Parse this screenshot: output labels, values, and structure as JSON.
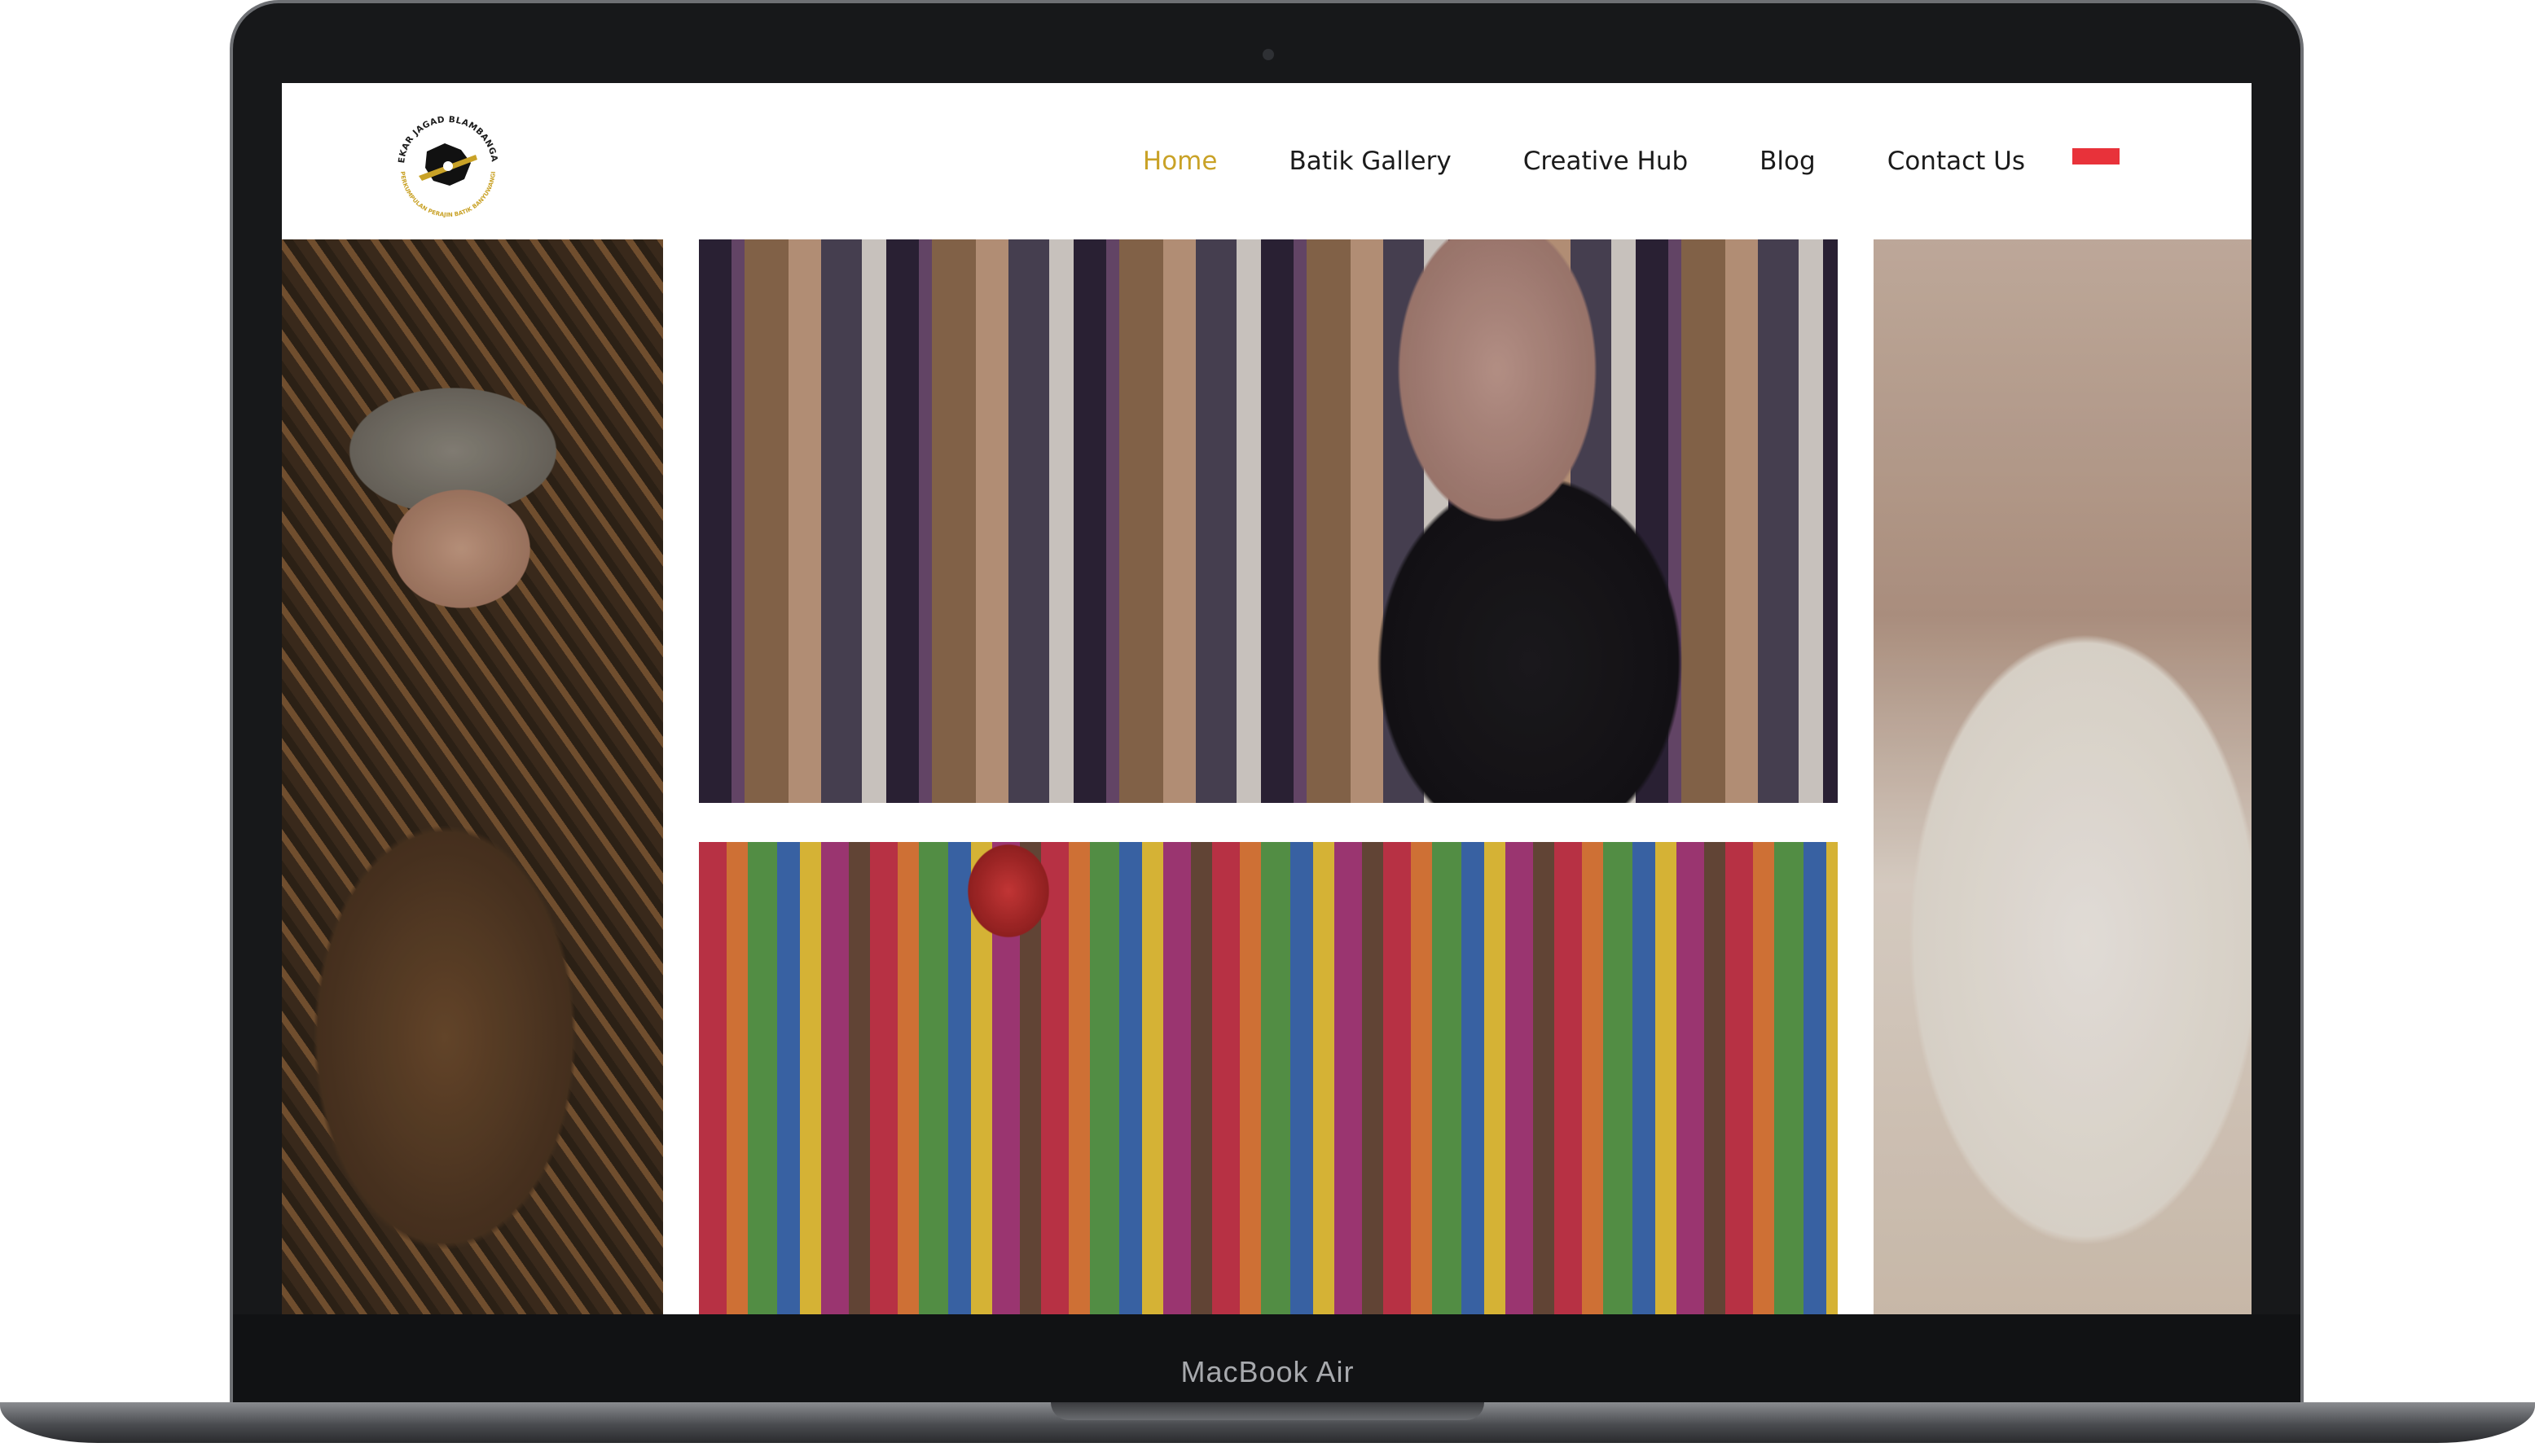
{
  "device": {
    "model_label": "MacBook Air"
  },
  "site": {
    "logo": {
      "text_top": "SEKAR JAGAD BLAMBANGAN",
      "text_bottom": "PERKUMPULAN PERAJIN BATIK BANYUWANGI"
    },
    "nav": {
      "items": [
        {
          "label": "Home",
          "active": true
        },
        {
          "label": "Batik Gallery",
          "active": false
        },
        {
          "label": "Creative Hub",
          "active": false
        },
        {
          "label": "Blog",
          "active": false
        },
        {
          "label": "Contact Us",
          "active": false
        }
      ],
      "active_color": "#c9a227",
      "language_flag": "indonesia-flag-icon"
    },
    "hero": {
      "panels": [
        {
          "name": "artisan-inspecting-batik-photo"
        },
        {
          "name": "woman-browsing-batik-photo"
        },
        {
          "name": "batik-shop-interior-photo"
        },
        {
          "name": "batik-tulis-process-photo"
        }
      ]
    }
  }
}
